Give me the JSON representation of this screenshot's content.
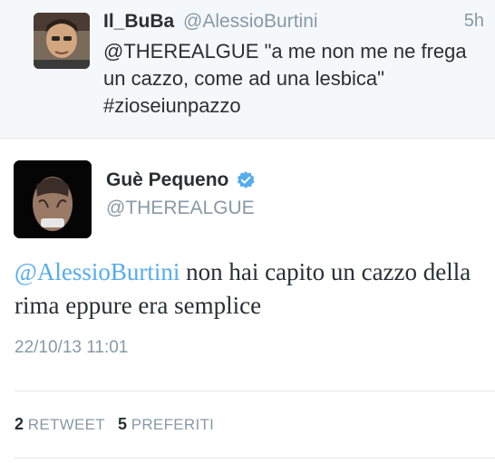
{
  "reply_tweet": {
    "name": "Il_BuBa",
    "handle": "@AlessioBurtini",
    "time": "5h",
    "text": "@THEREALGUE \"a me non me ne frega un cazzo, come ad una lesbica\" #zioseiunpazzo"
  },
  "main_tweet": {
    "name": "Guè Pequeno",
    "handle": "@THEREALGUE",
    "mention": "@AlessioBurtini",
    "text_rest": " non hai capito un cazzo della rima eppure era semplice",
    "timestamp": "22/10/13 11:01",
    "retweets_count": "2",
    "retweets_label": "RETWEET",
    "favorites_count": "5",
    "favorites_label": "PREFERITI"
  },
  "icons": {
    "verified": "verified-badge-icon"
  },
  "colors": {
    "link": "#55acee",
    "secondary_text": "#8899a6",
    "reply_background": "#f5f8fa"
  }
}
